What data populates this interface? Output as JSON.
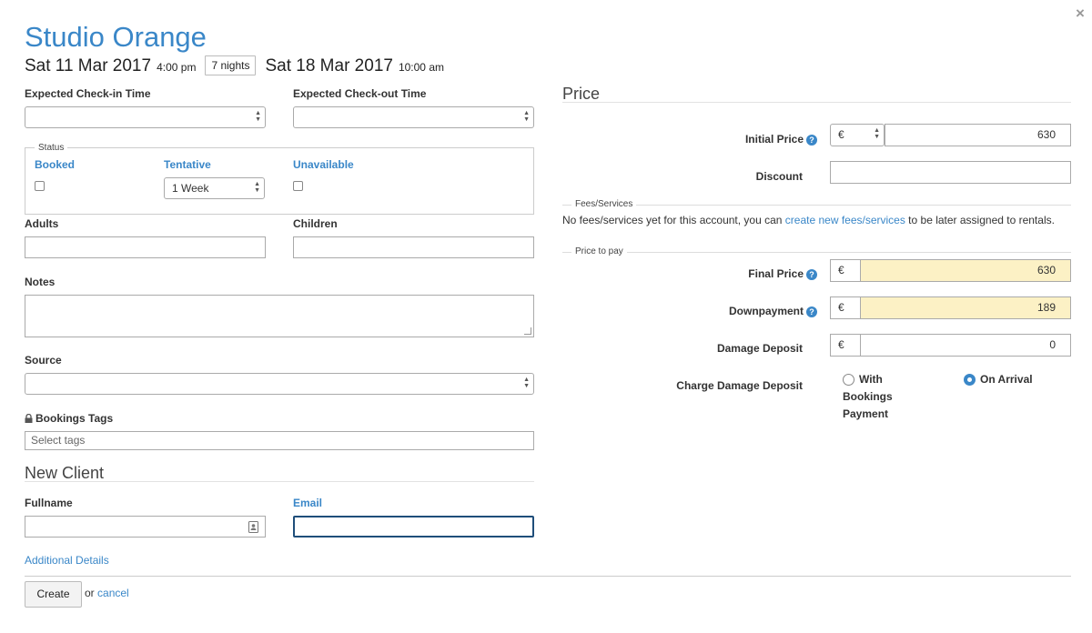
{
  "close_label": "×",
  "title": "Studio Orange",
  "dates": {
    "checkin_date": "Sat 11 Mar 2017",
    "checkin_time": "4:00 pm",
    "nights": "7 nights",
    "checkout_date": "Sat 18 Mar 2017",
    "checkout_time": "10:00 am"
  },
  "form": {
    "expected_checkin_label": "Expected Check-in Time",
    "expected_checkin_value": "",
    "expected_checkout_label": "Expected Check-out Time",
    "expected_checkout_value": "",
    "status_legend": "Status",
    "status_booked_label": "Booked",
    "status_booked_checked": false,
    "status_tentative_label": "Tentative",
    "status_tentative_value": "1 Week",
    "status_unavailable_label": "Unavailable",
    "status_unavailable_checked": false,
    "adults_label": "Adults",
    "adults_value": "",
    "children_label": "Children",
    "children_value": "",
    "notes_label": "Notes",
    "notes_value": "",
    "source_label": "Source",
    "source_value": "",
    "tags_label": "Bookings Tags",
    "tags_placeholder": "Select tags"
  },
  "client": {
    "heading": "New Client",
    "fullname_label": "Fullname",
    "fullname_value": "",
    "email_label": "Email",
    "email_value": "",
    "additional_details": "Additional Details"
  },
  "price": {
    "heading": "Price",
    "initial_price_label": "Initial Price",
    "currency": "€",
    "initial_price_value": "630",
    "discount_label": "Discount",
    "discount_value": "",
    "fees_legend": "Fees/Services",
    "fees_text_before": "No fees/services yet for this account, you can ",
    "fees_link": "create new fees/services",
    "fees_text_after": " to be later assigned to rentals.",
    "price_to_pay_legend": "Price to pay",
    "final_price_label": "Final Price",
    "final_price_value": "630",
    "downpayment_label": "Downpayment",
    "downpayment_value": "189",
    "damage_deposit_label": "Damage Deposit",
    "damage_deposit_value": "0",
    "charge_damage_deposit_label": "Charge Damage Deposit",
    "option_with_bookings_payment": "With Bookings Payment",
    "option_on_arrival": "On Arrival",
    "selected_option": "On Arrival",
    "help_glyph": "?"
  },
  "footer": {
    "create_label": "Create",
    "or_text": "or",
    "cancel_label": "cancel"
  },
  "colors": {
    "accent": "#3a87c8",
    "highlight_input": "#fcf1c5"
  }
}
